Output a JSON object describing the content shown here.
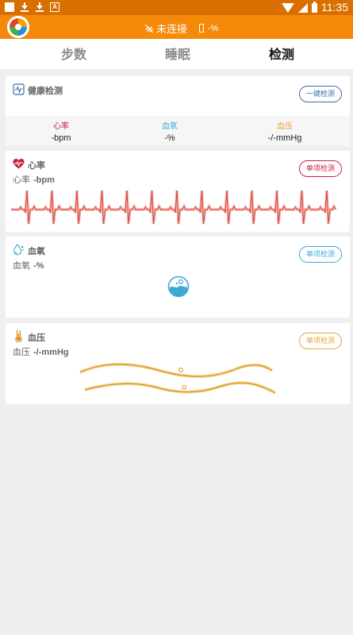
{
  "status_bar": {
    "time": "11:35"
  },
  "app_bar": {
    "connection_text": "未连接",
    "battery_text": "-%"
  },
  "tabs": [
    {
      "label": "步数",
      "active": false
    },
    {
      "label": "睡眠",
      "active": false
    },
    {
      "label": "检测",
      "active": true
    }
  ],
  "health_check": {
    "title": "健康检测",
    "button_label": "一键检测",
    "metrics": [
      {
        "label": "心率",
        "value": "-bpm",
        "color": "#c8233a"
      },
      {
        "label": "血氧",
        "value": "-%",
        "color": "#3fa7d8"
      },
      {
        "label": "血压",
        "value": "-/-mmHg",
        "color": "#e9a23a"
      }
    ]
  },
  "heart_rate": {
    "title": "心率",
    "sub_label": "心率",
    "sub_value": "-bpm",
    "button_label": "单项检测",
    "color": "#c8233a"
  },
  "blood_oxygen": {
    "title": "血氧",
    "sub_label": "血氧",
    "sub_value": "-%",
    "button_label": "单项检测",
    "color": "#3fa7d8"
  },
  "blood_pressure": {
    "title": "血压",
    "sub_label": "血压",
    "sub_value": "-/-mmHg",
    "button_label": "单项检测",
    "color": "#e9a23a"
  }
}
